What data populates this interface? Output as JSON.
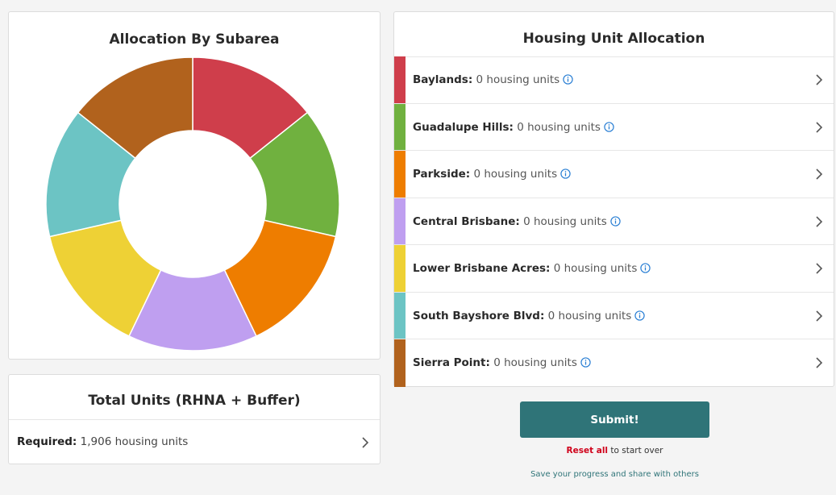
{
  "chart_panel": {
    "title": "Allocation By Subarea"
  },
  "chart_data": {
    "type": "pie",
    "donut": true,
    "categories": [
      "Baylands",
      "Guadalupe Hills",
      "Parkside",
      "Central Brisbane",
      "Lower Brisbane Acres",
      "South Bayshore Blvd",
      "Sierra Point"
    ],
    "values": [
      1,
      1,
      1,
      1,
      1,
      1,
      1
    ],
    "colors": [
      "#cf3e4b",
      "#70b13f",
      "#ee7d00",
      "#bf9ff0",
      "#eed135",
      "#6cc4c4",
      "#b1621d"
    ]
  },
  "total_panel": {
    "title": "Total Units (RHNA + Buffer)",
    "required_label": "Required:",
    "required_value": "1,906 housing units"
  },
  "allocation_panel": {
    "title": "Housing Unit Allocation",
    "items": [
      {
        "name": "Baylands:",
        "value": "0 housing units",
        "color": "#cf3e4b"
      },
      {
        "name": "Guadalupe Hills:",
        "value": "0 housing units",
        "color": "#70b13f"
      },
      {
        "name": "Parkside:",
        "value": "0 housing units",
        "color": "#ee7d00"
      },
      {
        "name": "Central Brisbane:",
        "value": "0 housing units",
        "color": "#bf9ff0"
      },
      {
        "name": "Lower Brisbane Acres:",
        "value": "0 housing units",
        "color": "#eed135"
      },
      {
        "name": "South Bayshore Blvd:",
        "value": "0 housing units",
        "color": "#6cc4c4"
      },
      {
        "name": "Sierra Point:",
        "value": "0 housing units",
        "color": "#b1621d"
      }
    ]
  },
  "actions": {
    "submit_label": "Submit!",
    "reset_label": "Reset all",
    "reset_suffix": " to start over",
    "save_label": "Save your progress and share with others"
  },
  "icons": {
    "info": "info-circle-icon",
    "chevron": "chevron-right-icon"
  },
  "colors": {
    "accent": "#2f7478",
    "reset": "#d0021b",
    "info": "#2a7fd4"
  }
}
